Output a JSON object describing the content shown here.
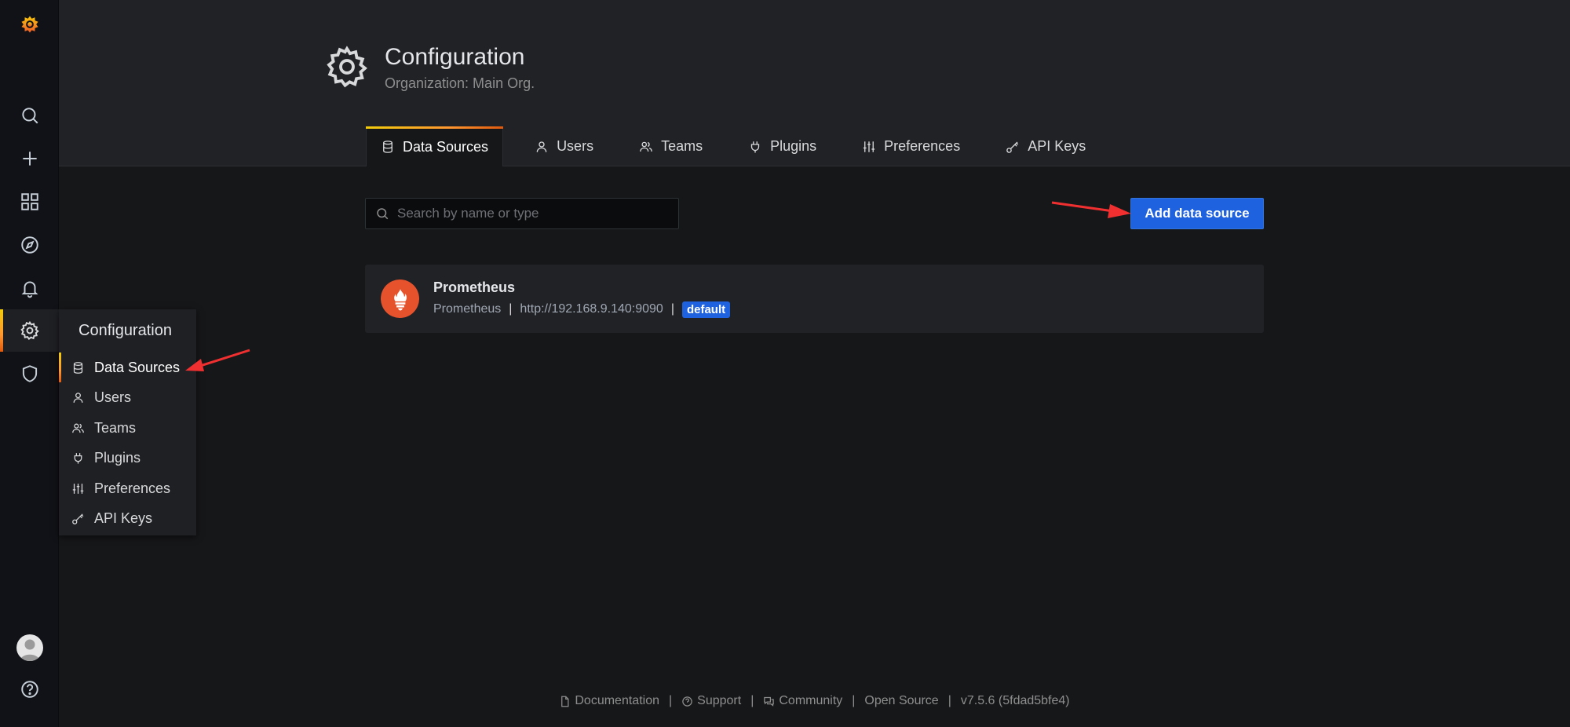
{
  "header": {
    "title": "Configuration",
    "subtitle": "Organization: Main Org."
  },
  "tabs": [
    {
      "label": "Data Sources",
      "icon": "database-icon",
      "active": true
    },
    {
      "label": "Users",
      "icon": "user-icon"
    },
    {
      "label": "Teams",
      "icon": "users-icon"
    },
    {
      "label": "Plugins",
      "icon": "plug-icon"
    },
    {
      "label": "Preferences",
      "icon": "sliders-icon"
    },
    {
      "label": "API Keys",
      "icon": "key-icon"
    }
  ],
  "search": {
    "placeholder": "Search by name or type",
    "value": ""
  },
  "add_button": {
    "label": "Add data source"
  },
  "datasource": {
    "name": "Prometheus",
    "type": "Prometheus",
    "sep": "|",
    "url": "http://192.168.9.140:9090",
    "badge": "default"
  },
  "flyout": {
    "title": "Configuration",
    "items": [
      {
        "label": "Data Sources",
        "icon": "database-icon",
        "active": true
      },
      {
        "label": "Users",
        "icon": "user-icon"
      },
      {
        "label": "Teams",
        "icon": "users-icon"
      },
      {
        "label": "Plugins",
        "icon": "plug-icon"
      },
      {
        "label": "Preferences",
        "icon": "sliders-icon"
      },
      {
        "label": "API Keys",
        "icon": "key-icon"
      }
    ]
  },
  "sidebar": {
    "items": [
      "grafana-logo-icon",
      "search-icon",
      "plus-icon",
      "dashboards-icon",
      "explore-icon",
      "alerting-icon",
      "gear-icon",
      "shield-icon",
      "avatar",
      "help-icon"
    ]
  },
  "footer": {
    "documentation": "Documentation",
    "support": "Support",
    "community": "Community",
    "open_source": "Open Source",
    "version": "v7.5.6 (5fdad5bfe4)",
    "sep": "|"
  },
  "colors": {
    "accent": "#1f62e0",
    "annotation_arrow": "#f03030",
    "prometheus": "#e6522c",
    "active_gradient": "#ff9830"
  }
}
